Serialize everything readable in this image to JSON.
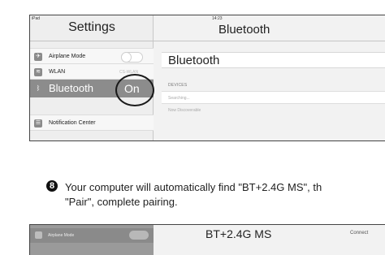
{
  "screenshot1": {
    "status_left": "iPad",
    "status_time": "14:23",
    "sidebar_title": "Settings",
    "detail_title": "Bluetooth",
    "rows": {
      "airplane_label": "Airplane Mode",
      "wlan_label": "WLAN",
      "wlan_value": "CS-WLAN",
      "bluetooth_label": "Bluetooth",
      "bluetooth_value": "On",
      "notification_label": "Notification Center"
    },
    "panel": {
      "bluetooth_label": "Bluetooth",
      "devices_header": "DEVICES",
      "searching_text": "Searching...",
      "discoverable_text": "Now Discoverable"
    }
  },
  "instruction": {
    "step_number": "8",
    "line1": "Your computer will automatically find \"BT+2.4G MS\", th",
    "line2": "\"Pair\", complete pairing."
  },
  "screenshot2": {
    "row_label": "Airplane Mode",
    "device_title": "BT+2.4G MS",
    "connect_text": "Connect"
  },
  "colors": {
    "selected_row": "#8c8c8c",
    "sidebar_bg": "#eeeeee",
    "panel_bg": "#f2f2f2"
  }
}
